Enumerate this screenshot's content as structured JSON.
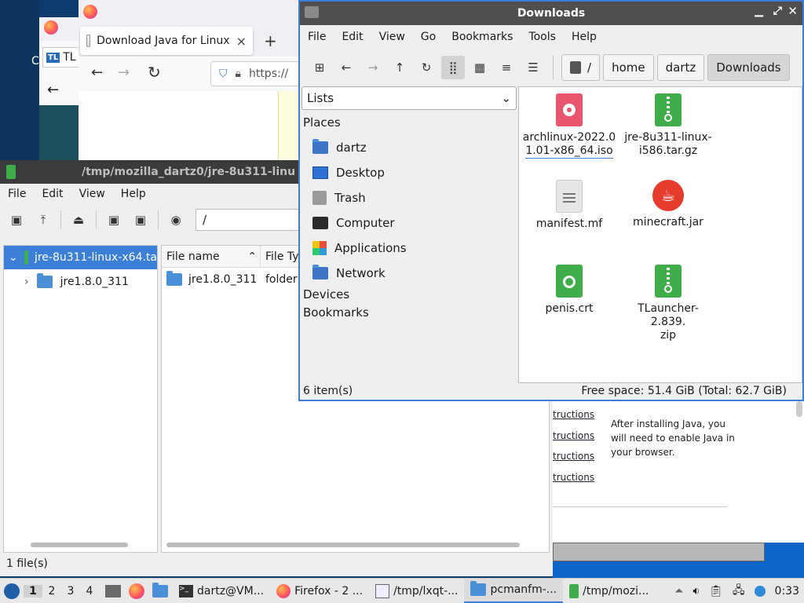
{
  "firefox": {
    "tab_label": "Download Java for Linux",
    "tab_close": "×",
    "new_tab": "+",
    "url_prefix": "https://",
    "side_tab_label": "TL",
    "side_tab_prefix": "C",
    "page": {
      "links": [
        "tructions",
        "tructions",
        "tructions",
        "tructions"
      ],
      "note": "After installing Java, you will need to enable Java in your browser."
    }
  },
  "archive": {
    "title": "/tmp/mozilla_dartz0/jre-8u311-linu",
    "menu": [
      "File",
      "Edit",
      "View",
      "Help"
    ],
    "path_value": "/",
    "tree_root": "jre-8u311-linux-x64.ta",
    "tree_child": "jre1.8.0_311",
    "columns": [
      "File name",
      "File Ty"
    ],
    "rows": [
      {
        "name": "jre1.8.0_311",
        "type": "folder"
      }
    ],
    "status": "1 file(s)"
  },
  "pcmanfm": {
    "title": "Downloads",
    "menu": [
      "File",
      "Edit",
      "View",
      "Go",
      "Bookmarks",
      "Tools",
      "Help"
    ],
    "path": [
      "/",
      "home",
      "dartz",
      "Downloads"
    ],
    "view_select": "Lists",
    "places_header": "Places",
    "places": [
      {
        "label": "dartz",
        "icon": "home-folder-icon"
      },
      {
        "label": "Desktop",
        "icon": "desktop-icon"
      },
      {
        "label": "Trash",
        "icon": "trash-icon"
      },
      {
        "label": "Computer",
        "icon": "computer-icon"
      },
      {
        "label": "Applications",
        "icon": "applications-icon"
      },
      {
        "label": "Network",
        "icon": "network-icon"
      }
    ],
    "devices_header": "Devices",
    "bookmarks_header": "Bookmarks",
    "files": [
      {
        "name": "archlinux-2022.01.01-x86_64.iso",
        "line1": "archlinux-2022.0",
        "line2": "1.01-x86_64.iso",
        "icon": "disc-image-icon",
        "color": "#e8566e"
      },
      {
        "name": "jre-8u311-linux-i586.tar.gz",
        "line1": "jre-8u311-linux-",
        "line2": "i586.tar.gz",
        "icon": "archive-icon",
        "color": "#3fae4a"
      },
      {
        "name": "manifest.mf",
        "line1": "manifest.mf",
        "line2": "",
        "icon": "text-file-icon",
        "color": "#e6e6e6"
      },
      {
        "name": "minecraft.jar",
        "line1": "minecraft.jar",
        "line2": "",
        "icon": "java-icon",
        "color": "#e53b2c"
      },
      {
        "name": "penis.crt",
        "line1": "penis.crt",
        "line2": "",
        "icon": "certificate-icon",
        "color": "#3fae4a"
      },
      {
        "name": "TLauncher-2.839.zip",
        "line1": "TLauncher-2.839.",
        "line2": "zip",
        "icon": "archive-icon",
        "color": "#3fae4a"
      }
    ],
    "status_count": "6 item(s)",
    "status_space": "Free space: 51.4 GiB (Total: 62.7 GiB)"
  },
  "taskbar": {
    "desktops": [
      "1",
      "2",
      "3",
      "4"
    ],
    "tasks": [
      {
        "label": "dartz@VM...",
        "icon": "terminal-icon"
      },
      {
        "label": "Firefox - 2 ...",
        "icon": "firefox-icon"
      },
      {
        "label": "/tmp/lxqt-...",
        "icon": "text-editor-icon"
      },
      {
        "label": "pcmanfm-...",
        "icon": "folder-icon"
      },
      {
        "label": "/tmp/mozi...",
        "icon": "archive-icon"
      }
    ],
    "clock": "0:33"
  }
}
